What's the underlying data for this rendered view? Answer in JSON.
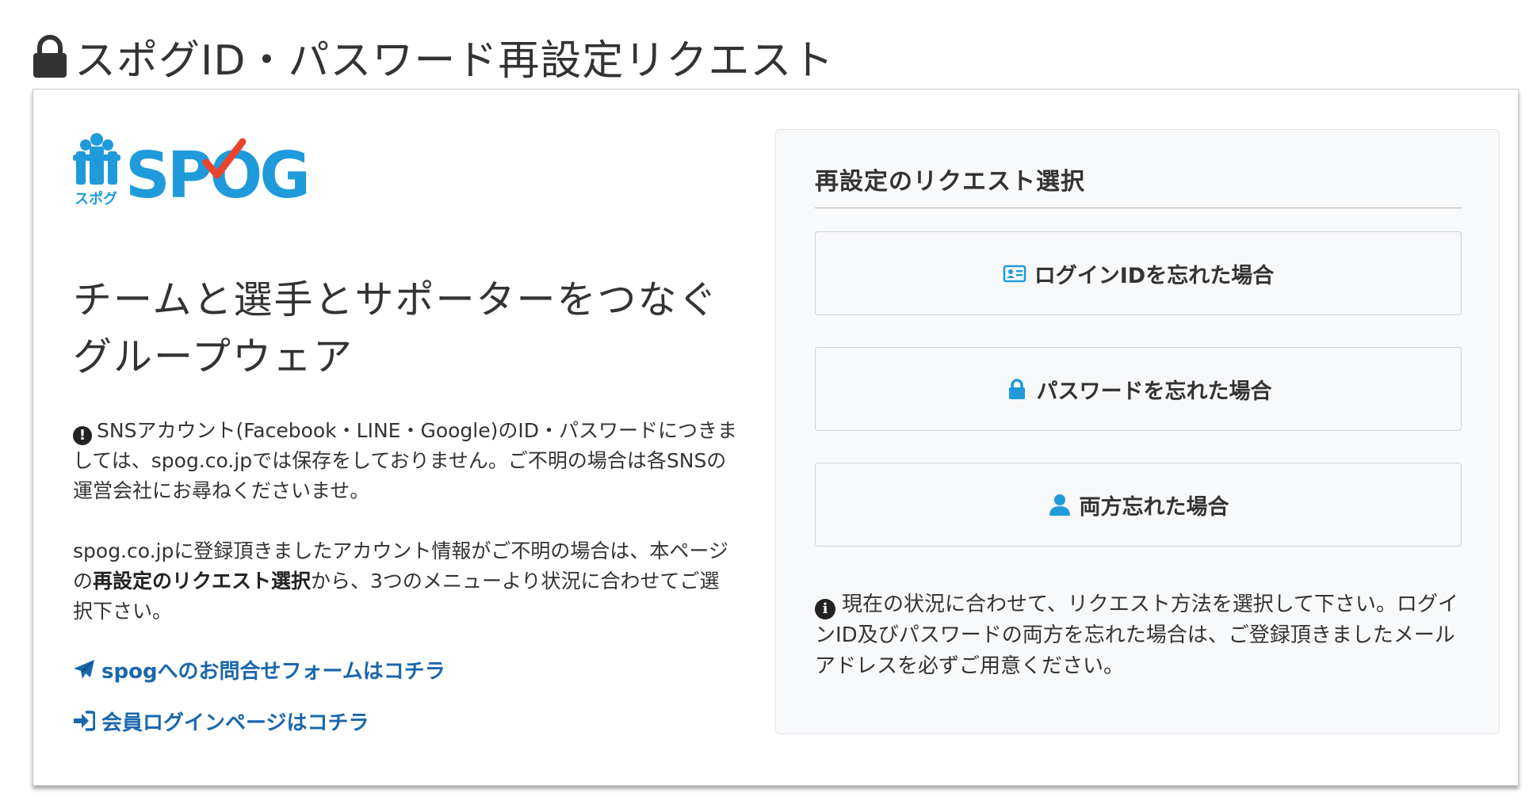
{
  "page": {
    "title": "スポグID・パスワード再設定リクエスト"
  },
  "brand": {
    "logo_text": "SPOG",
    "logo_sub": "スポグ",
    "colors": {
      "logo_blue": "#1f9bdc",
      "logo_check": "#e8452c",
      "link_blue": "#1a67ad"
    }
  },
  "left": {
    "tagline_line1": "チームと選手とサポーターをつなぐ",
    "tagline_line2": "グループウェア",
    "notice_icon": "exclamation-circle-icon",
    "notice_text": "SNSアカウント(Facebook・LINE・Google)のID・パスワードにつきましては、spog.co.jpでは保存をしておりません。ご不明の場合は各SNSの運営会社にお尋ねくださいませ。",
    "help_prefix": "spog.co.jpに登録頂きましたアカウント情報がご不明の場合は、本ページの",
    "help_bold": "再設定のリクエスト選択",
    "help_suffix": "から、3つのメニューより状況に合わせてご選択下さい。",
    "links": [
      {
        "label": "spogへのお問合せフォームはコチラ",
        "icon": "paper-plane-icon"
      },
      {
        "label": "会員ログインページはコチラ",
        "icon": "sign-in-icon"
      }
    ]
  },
  "panel": {
    "title": "再設定のリクエスト選択",
    "buttons": [
      {
        "label": "ログインIDを忘れた場合",
        "icon": "id-card-icon"
      },
      {
        "label": "パスワードを忘れた場合",
        "icon": "lock-icon"
      },
      {
        "label": "両方忘れた場合",
        "icon": "user-icon"
      }
    ],
    "note_icon": "info-circle-icon",
    "note_text": "現在の状況に合わせて、リクエスト方法を選択して下さい。ログインID及びパスワードの両方を忘れた場合は、ご登録頂きましたメールアドレスを必ずご用意ください。"
  }
}
